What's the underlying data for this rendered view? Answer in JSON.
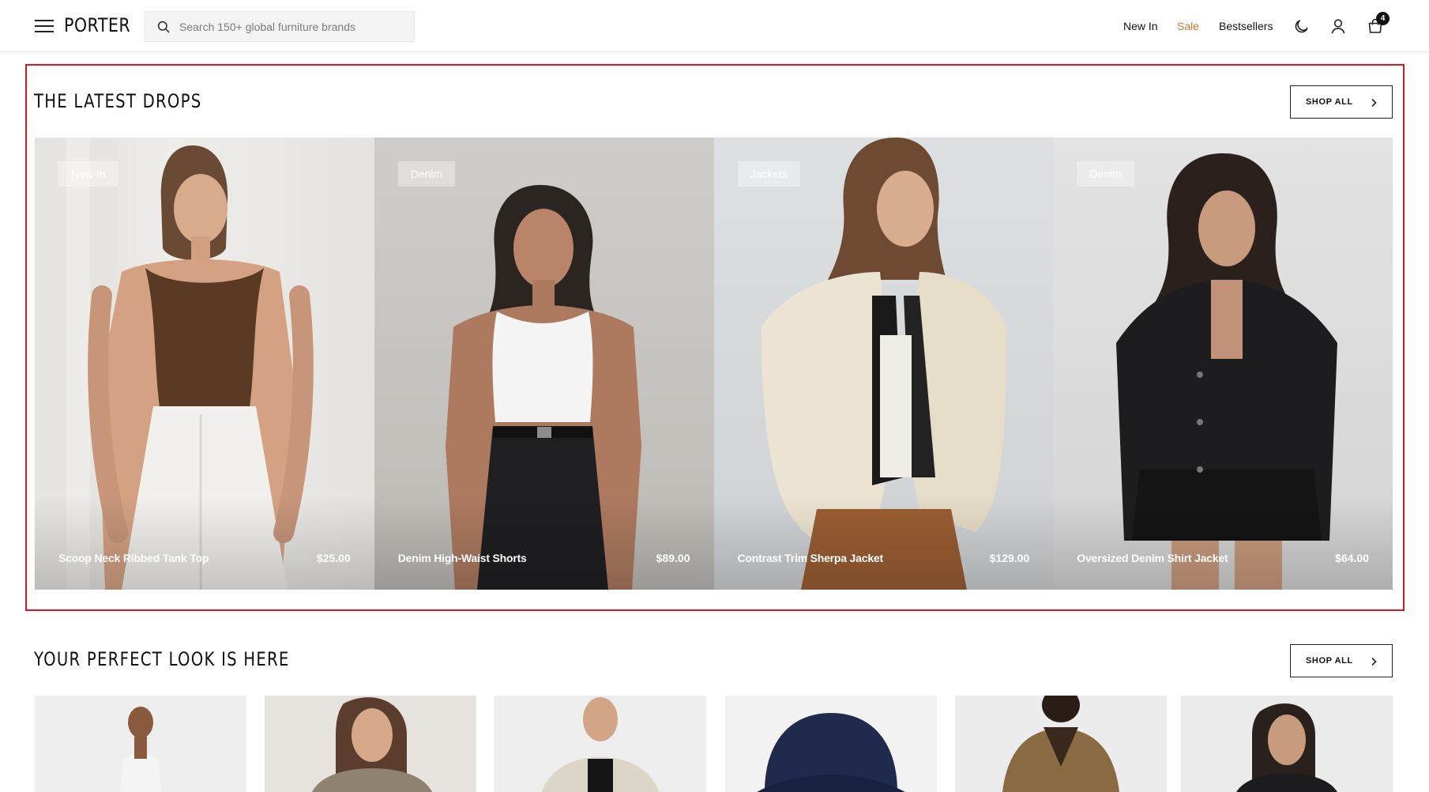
{
  "header": {
    "logo": "PORTER",
    "search_placeholder": "Search 150+ global furniture brands",
    "nav": {
      "new_in": "New In",
      "sale": "Sale",
      "bestsellers": "Bestsellers"
    },
    "cart_count": "4",
    "icons": [
      "menu-icon",
      "search-icon",
      "moon-icon",
      "user-icon",
      "shopping-bag-icon"
    ],
    "sale_color": "#c67b2d"
  },
  "latest_drops": {
    "title": "THE LATEST DROPS",
    "shop_all": "SHOP ALL",
    "products": [
      {
        "tag": "New In",
        "name": "Scoop Neck Ribbed Tank Top",
        "price": "$25.00"
      },
      {
        "tag": "Denim",
        "name": "Denim High-Waist Shorts",
        "price": "$89.00"
      },
      {
        "tag": "Jackets",
        "name": "Contrast Trim Sherpa Jacket",
        "price": "$129.00"
      },
      {
        "tag": "Denim",
        "name": "Oversized Denim Shirt Jacket",
        "price": "$64.00"
      }
    ]
  },
  "perfect_look": {
    "title": "YOUR PERFECT LOOK IS HERE",
    "shop_all": "SHOP ALL"
  },
  "highlight_color": "#e0141e"
}
